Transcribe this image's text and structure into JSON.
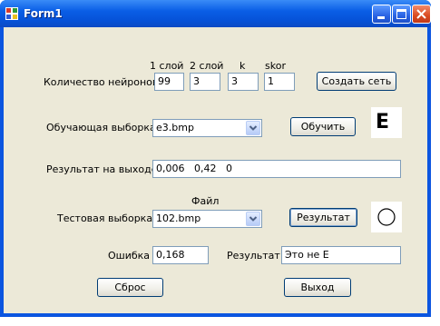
{
  "window": {
    "title": "Form1"
  },
  "headers": {
    "layer1": "1 слой",
    "layer2": "2 слой",
    "k": "k",
    "skor": "skor"
  },
  "neurons": {
    "label": "Количество нейронов",
    "layer1": "99",
    "layer2": "3",
    "k": "3",
    "skor": "1"
  },
  "create_button": "Создать сеть",
  "training": {
    "label": "Обучающая выборка",
    "selected": "e3.bmp",
    "button": "Обучить",
    "preview_letter": "E"
  },
  "output": {
    "label": "Результат на выходе",
    "value": "0,006   0,42   0"
  },
  "test": {
    "file_label": "Файл",
    "label": "Тестовая выборка",
    "selected": "102.bmp",
    "button": "Результат"
  },
  "error": {
    "label": "Ошибка",
    "value": "0,168"
  },
  "result": {
    "label": "Результат",
    "value": "Это не Е"
  },
  "reset_button": "Сброс",
  "exit_button": "Выход",
  "colors": {
    "titlebar": "#0a5ee6",
    "form_bg": "#ece9d8",
    "close_button": "#d94a20"
  }
}
